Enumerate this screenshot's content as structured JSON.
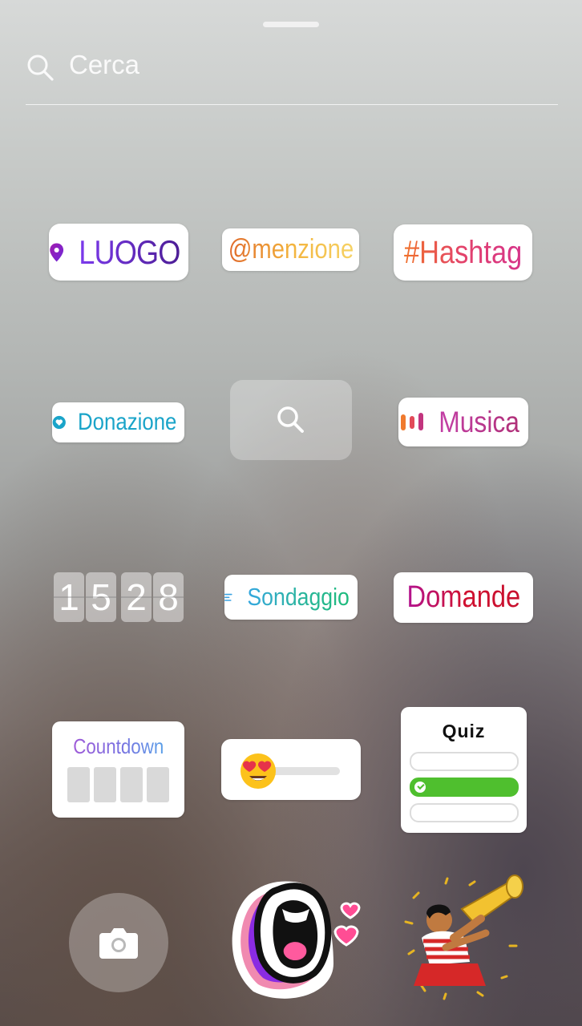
{
  "search": {
    "placeholder": "Cerca"
  },
  "stickers": {
    "location": "LUOGO",
    "mention": "@menzione",
    "hashtag": "#Hashtag",
    "donation": "Donazione",
    "music": "Musica",
    "clock": [
      "1",
      "5",
      "2",
      "8"
    ],
    "poll": "Sondaggio",
    "questions": "Domande",
    "countdown": "Countdown",
    "quiz": "Quiz"
  },
  "colors": {
    "location": "#6d28d9",
    "donation": "#1aa4c9",
    "quiz_correct": "#4fbf2e"
  },
  "icons": {
    "search": "search-icon",
    "pin": "location-pin-icon",
    "heart": "heart-icon",
    "music_bars": "music-bars-icon",
    "camera": "camera-icon"
  }
}
